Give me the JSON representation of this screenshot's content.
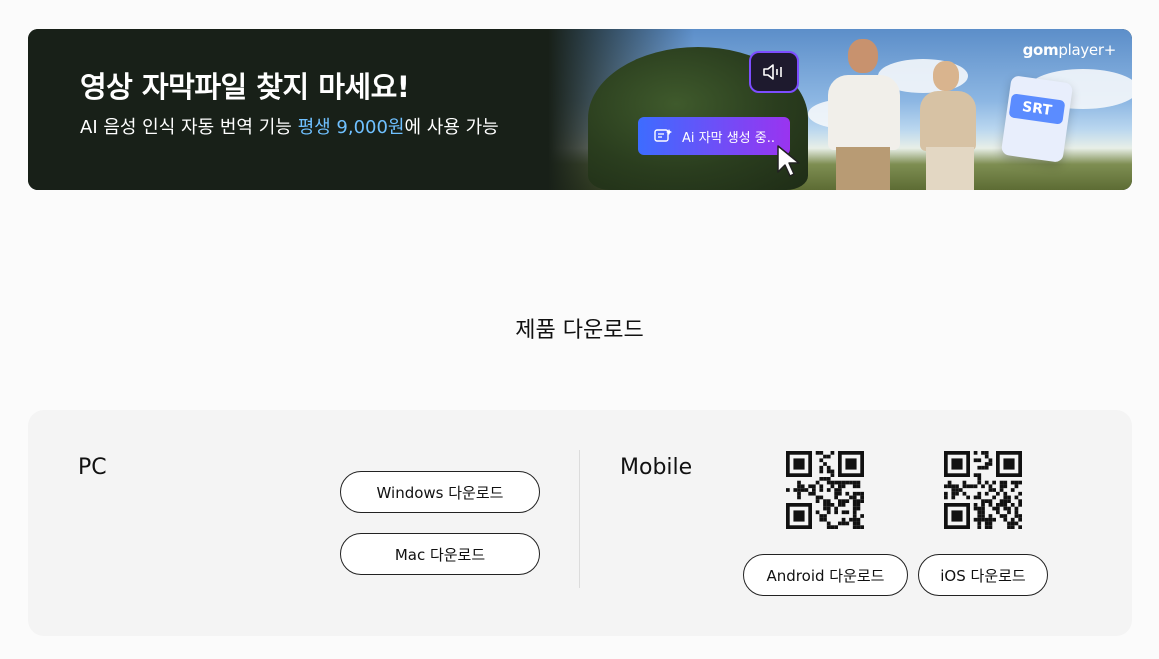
{
  "banner": {
    "title": "영상 자막파일 찾지 마세요!",
    "subtitle_pre": "AI 음성 인식 자동 번역 기능 ",
    "subtitle_highlight": "평생 9,000원",
    "subtitle_post": "에 사용 가능",
    "chip_label": "Ai 자막 생성 중..",
    "srt_label": "SRT",
    "logo_bold": "gom",
    "logo_light": "player+",
    "highlight_color": "#6fc0ff"
  },
  "section": {
    "title": "제품 다운로드"
  },
  "pc": {
    "label": "PC",
    "buttons": [
      {
        "label": "Windows 다운로드"
      },
      {
        "label": "Mac 다운로드"
      }
    ]
  },
  "mobile": {
    "label": "Mobile",
    "buttons": [
      {
        "label": "Android 다운로드"
      },
      {
        "label": "iOS 다운로드"
      }
    ]
  }
}
